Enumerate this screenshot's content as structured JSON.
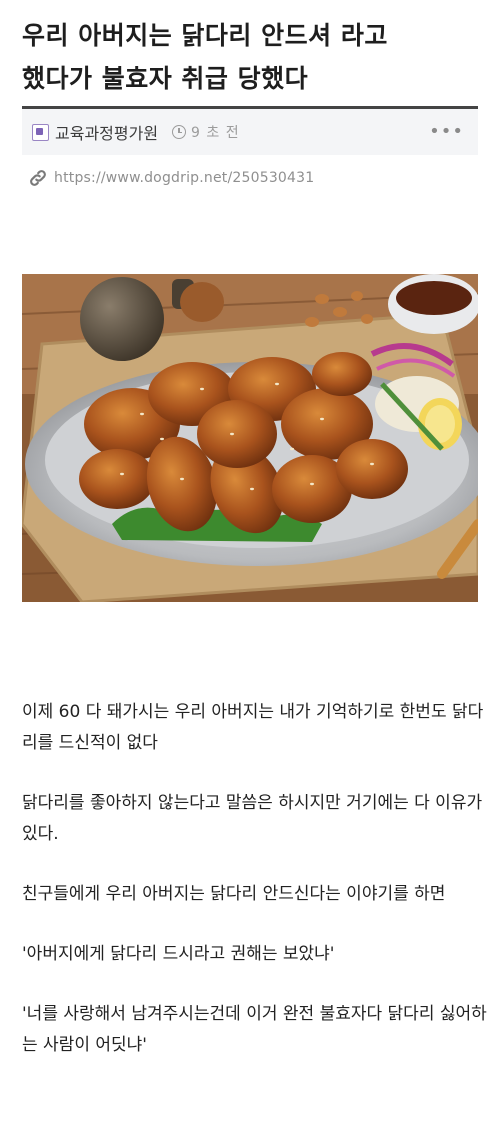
{
  "post": {
    "title_line1": "우리 아버지는 닭다리 안드셔 라고",
    "title_line2": "했다가 불효자 취급 당했다",
    "board": "교육과정평가원",
    "time_ago": "9 초 전",
    "more": "•••",
    "url": "https://www.dogdrip.net/250530431"
  },
  "image": {
    "description": "photo of glazed fried chicken drumsticks on a metal tray"
  },
  "body": {
    "p1": "이제 60 다 돼가시는 우리 아버지는 내가 기억하기로 한번도 닭다리를 드신적이 없다",
    "p2": "닭다리를 좋아하지 않는다고 말씀은 하시지만 거기에는 다 이유가 있다.",
    "p3": "친구들에게 우리 아버지는 닭다리 안드신다는 이야기를 하면",
    "p4": "'아버지에게 닭다리 드시라고 권해는 보았냐'",
    "p5": "'너를 사랑해서 남겨주시는건데 이거 완전 불효자다 닭다리 싫어하는 사람이 어딧냐'"
  },
  "colors": {
    "rule": "#444444",
    "meta_bg": "#f4f5f7",
    "meta_text": "#3c3c3c",
    "muted": "#9c9c9c"
  },
  "icons": [
    "board-icon",
    "clock-icon",
    "more-icon",
    "link-icon"
  ]
}
